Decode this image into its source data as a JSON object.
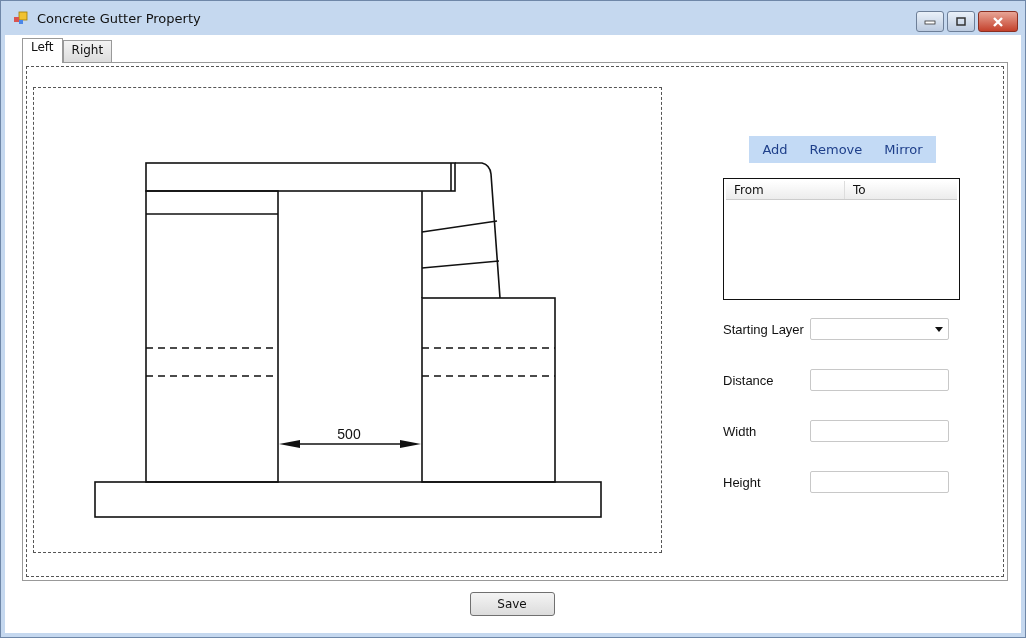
{
  "window": {
    "title": "Concrete Gutter Property"
  },
  "tabs": [
    {
      "label": "Left",
      "selected": true
    },
    {
      "label": "Right",
      "selected": false
    }
  ],
  "drawing": {
    "dimension": "500"
  },
  "toolbar": [
    "Add",
    "Remove",
    "Mirror"
  ],
  "list": {
    "columns": [
      "From",
      "To"
    ]
  },
  "fields": [
    {
      "label": "Starting Layer",
      "kind": "dropdown"
    },
    {
      "label": "Distance",
      "kind": "text"
    },
    {
      "label": "Width",
      "kind": "text"
    },
    {
      "label": "Height",
      "kind": "text"
    }
  ],
  "buttons": [
    "Save"
  ]
}
